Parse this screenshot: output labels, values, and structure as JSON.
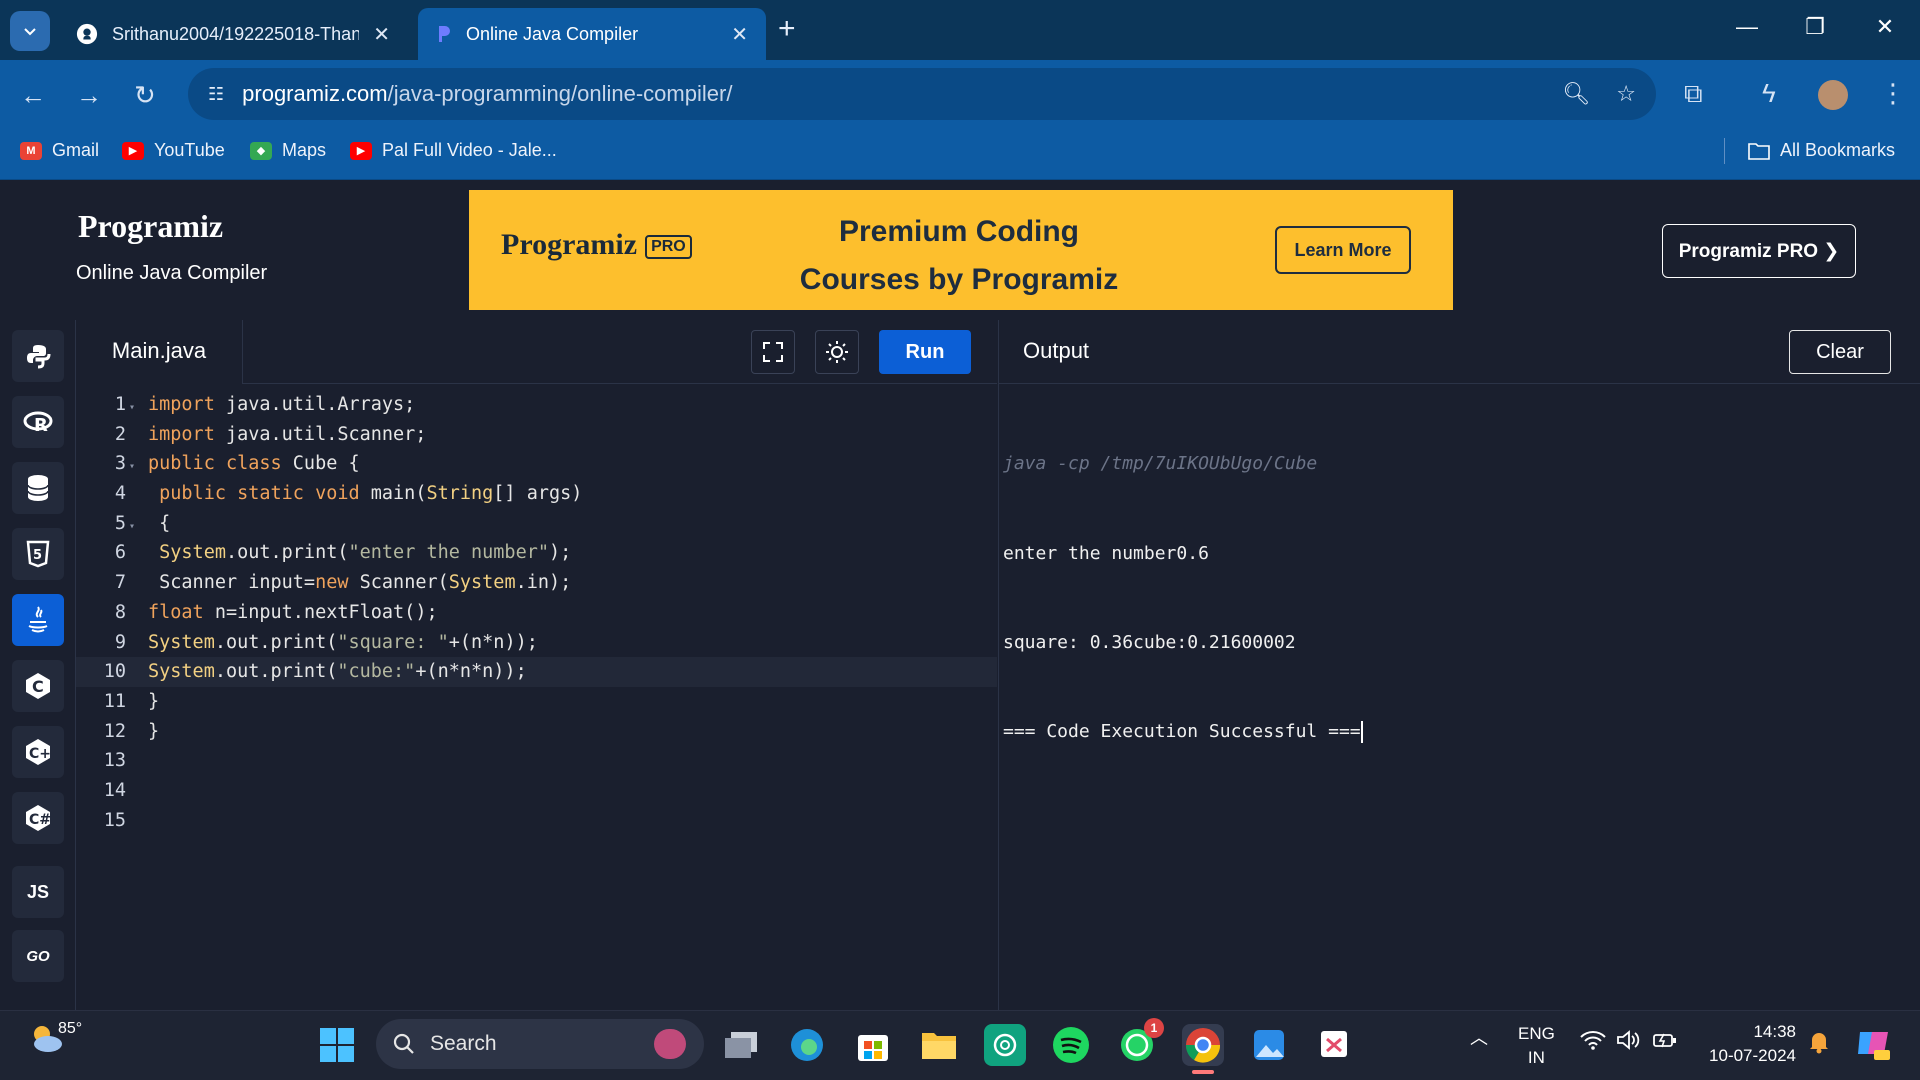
{
  "browser": {
    "tabs": [
      {
        "title": "Srithanu2004/192225018-Thanu",
        "icon": "github-icon"
      },
      {
        "title": "Online Java Compiler",
        "icon": "programiz-icon"
      }
    ],
    "url_host": "programiz.com",
    "url_path": "/java-programming/online-compiler/",
    "bookmarks": [
      {
        "label": "Gmail",
        "icon": "gmail-icon",
        "color": "#ea4335"
      },
      {
        "label": "YouTube",
        "icon": "youtube-icon",
        "color": "#ff0000"
      },
      {
        "label": "Maps",
        "icon": "maps-icon",
        "color": "#34a853"
      },
      {
        "label": "Pal Full Video - Jale...",
        "icon": "youtube-icon",
        "color": "#ff0000"
      }
    ],
    "all_bookmarks": "All Bookmarks"
  },
  "site": {
    "logo": "Programiz",
    "subtitle": "Online Java Compiler",
    "banner": {
      "logo": "Programiz",
      "pro": "PRO",
      "line1": "Premium Coding",
      "line2": "Courses by Programiz",
      "button": "Learn More"
    },
    "pro_button": "Programiz PRO ❯"
  },
  "languages": [
    "python",
    "r",
    "sql",
    "html",
    "java",
    "c",
    "cpp",
    "csharp",
    "JS",
    "GO"
  ],
  "editor": {
    "filename": "Main.java",
    "run_label": "Run",
    "lines": [
      {
        "n": "1",
        "fold": "▾",
        "html": "<span class='kw'>import</span> java.util.Arrays;"
      },
      {
        "n": "2",
        "fold": "",
        "html": "<span class='kw'>import</span> java.util.Scanner;"
      },
      {
        "n": "3",
        "fold": "▾",
        "html": "<span class='kw'>public class</span> Cube {"
      },
      {
        "n": "4",
        "fold": "",
        "html": " <span class='kw'>public static void</span> main(<span class='typ'>String</span>[] args)"
      },
      {
        "n": "5",
        "fold": "▾",
        "html": " {"
      },
      {
        "n": "6",
        "fold": "",
        "html": " <span class='typ'>System</span>.out.print(<span class='str'>\"enter the number\"</span>);"
      },
      {
        "n": "7",
        "fold": "",
        "html": " Scanner input=<span class='kw'>new</span> Scanner(<span class='typ'>System</span>.in);"
      },
      {
        "n": "8",
        "fold": "",
        "html": "<span class='kw'>float</span> n=input.nextFloat();"
      },
      {
        "n": "9",
        "fold": "",
        "html": "<span class='typ'>System</span>.out.print(<span class='str'>\"square: \"</span>+(n*n));"
      },
      {
        "n": "10",
        "fold": "",
        "html": "<span class='typ'>System</span>.out.print(<span class='str'>\"cube:\"</span>+(n*n*n));",
        "current": true
      },
      {
        "n": "11",
        "fold": "",
        "html": "}"
      },
      {
        "n": "12",
        "fold": "",
        "html": "}"
      },
      {
        "n": "13",
        "fold": "",
        "html": ""
      },
      {
        "n": "14",
        "fold": "",
        "html": ""
      },
      {
        "n": "15",
        "fold": "",
        "html": ""
      }
    ]
  },
  "output": {
    "title": "Output",
    "clear_label": "Clear",
    "command": "java -cp /tmp/7uIKOUbUgo/Cube",
    "lines": [
      "enter the number0.6",
      "square: 0.36cube:0.21600002",
      "=== Code Execution Successful ==="
    ]
  },
  "taskbar": {
    "weather": "85°",
    "search_placeholder": "Search",
    "lang_top": "ENG",
    "lang_bottom": "IN",
    "time": "14:38",
    "date": "10-07-2024",
    "whatsapp_badge": "1"
  }
}
